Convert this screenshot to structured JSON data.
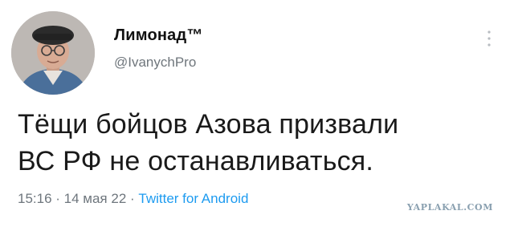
{
  "author": {
    "name": "Лимонад™",
    "handle": "@IvanychPro"
  },
  "tweet": {
    "text_line1": "Тёщи бойцов Азова призвали",
    "text_line2": "ВС РФ не останавливаться."
  },
  "meta": {
    "time": "15:16",
    "separator1": " · ",
    "date": "14 мая 22",
    "separator2": " · ",
    "source": "Twitter for Android"
  },
  "watermark": "YAPLAKAL.COM",
  "icons": {
    "more": "more-vertical-icon"
  },
  "colors": {
    "link": "#1d9bf0",
    "secondary_text": "#6e767d"
  }
}
